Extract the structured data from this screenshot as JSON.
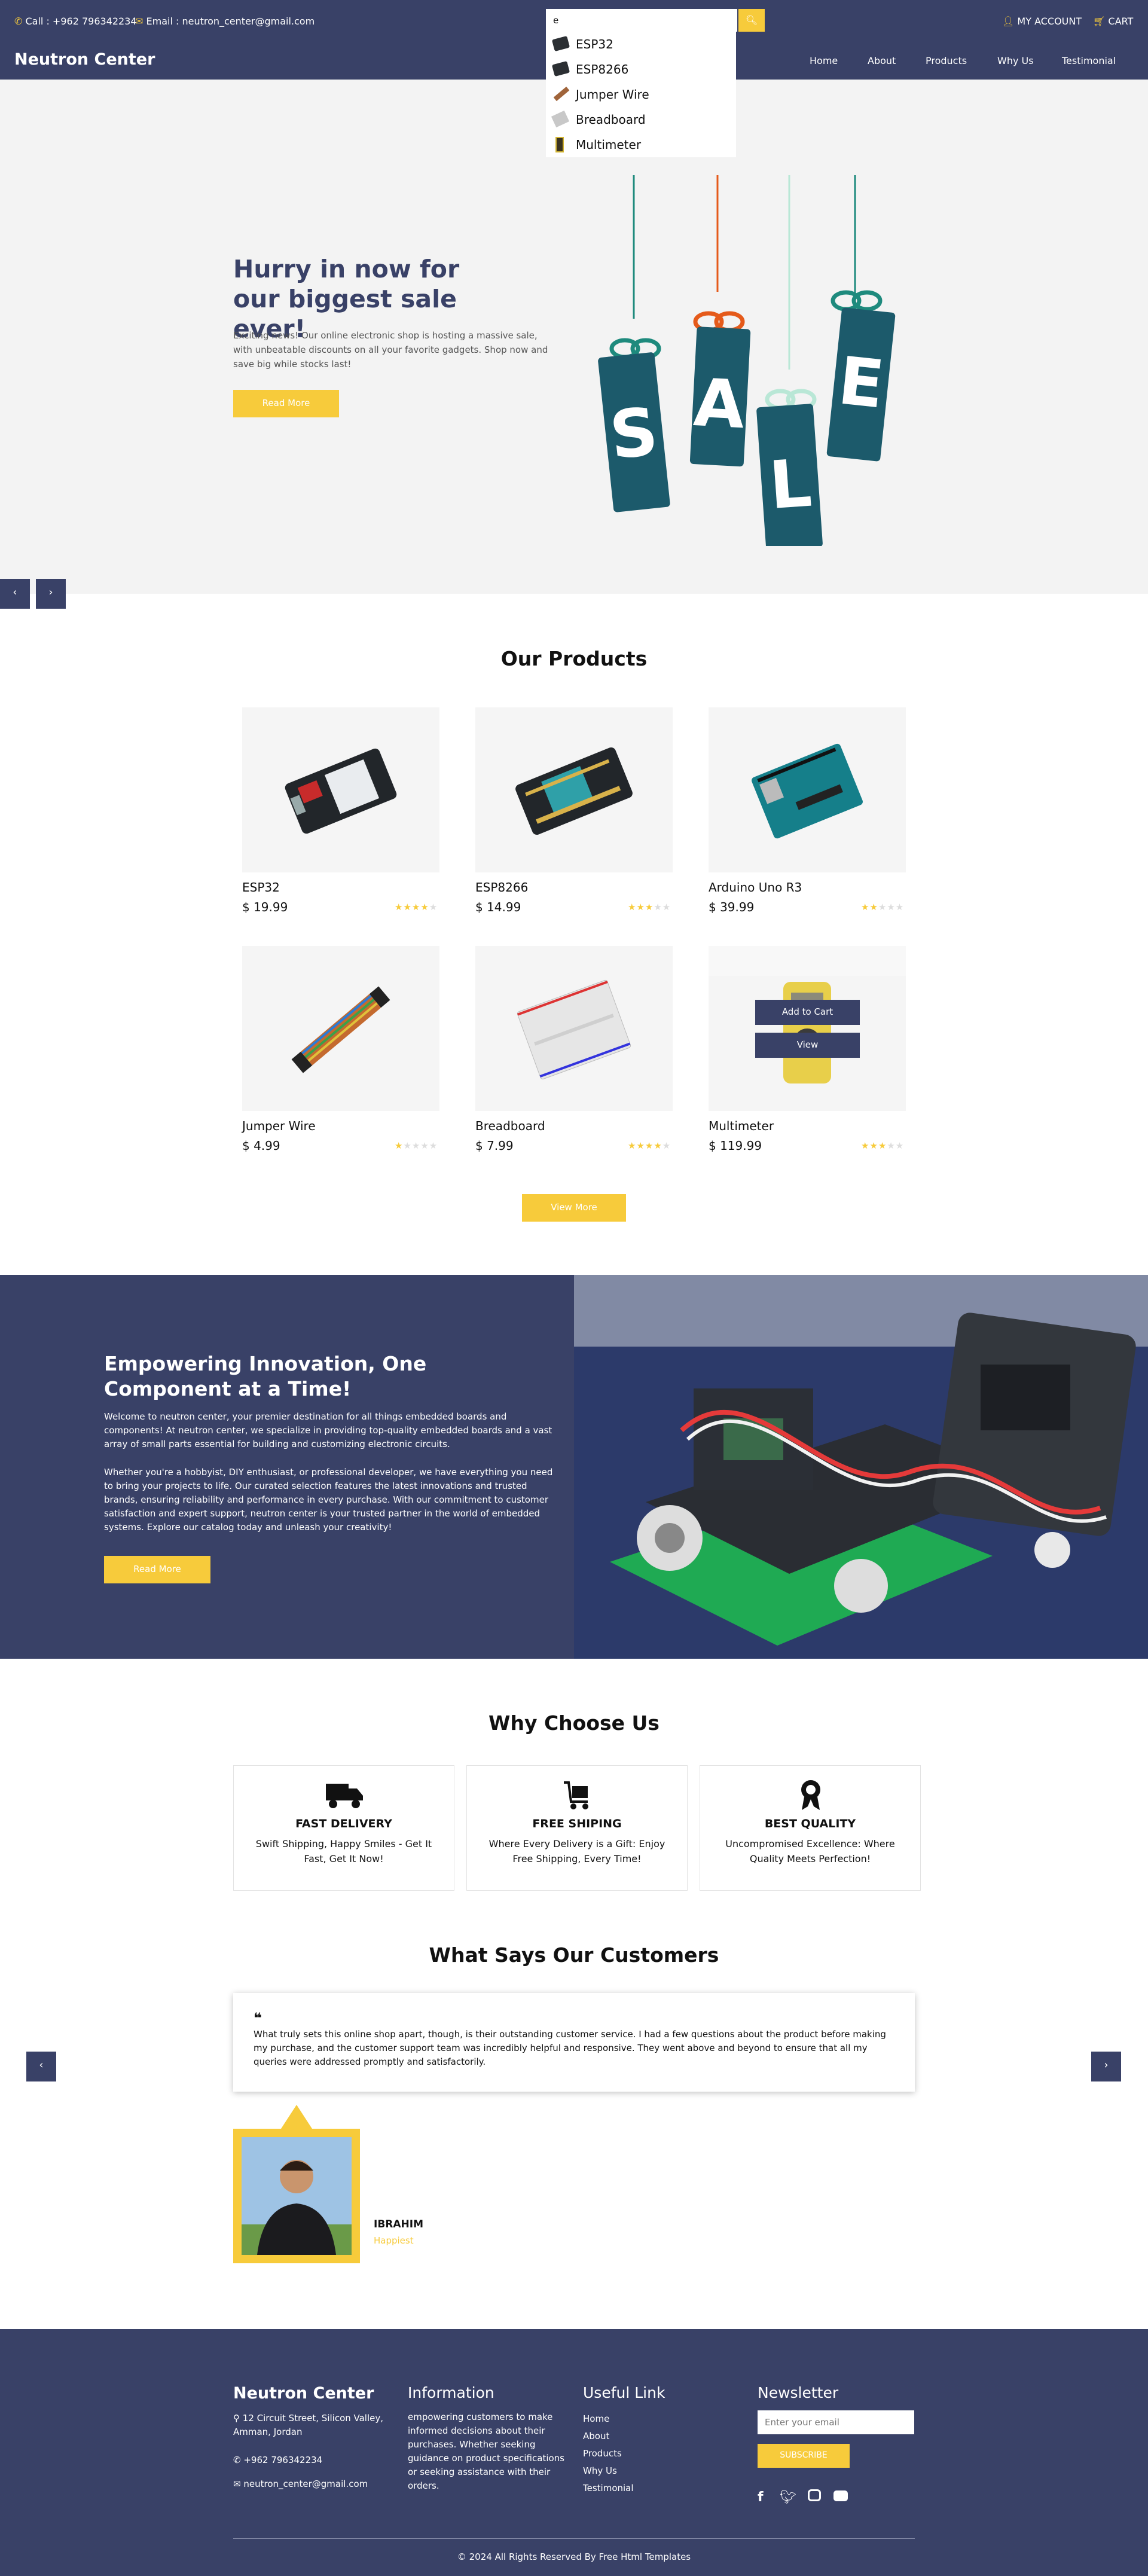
{
  "topbar": {
    "phone": "Call : +962 796342234",
    "email": "Email : neutron_center@gmail.com",
    "account": "MY ACCOUNT",
    "cart": "CART"
  },
  "search": {
    "value": "e",
    "placeholder": ""
  },
  "dropdown": [
    "ESP32",
    "ESP8266",
    "Jumper Wire",
    "Breadboard",
    "Multimeter"
  ],
  "brand": "Neutron Center",
  "nav": [
    "Home",
    "About",
    "Products",
    "Why Us",
    "Testimonial"
  ],
  "hero": {
    "title": "Hurry in now for our biggest sale ever!",
    "body": "Exciting news! Our online electronic shop is hosting a massive sale, with unbeatable discounts on all your favorite gadgets. Shop now and save big while stocks last!",
    "button": "Read More",
    "tags": [
      "S",
      "A",
      "L",
      "E"
    ]
  },
  "products": {
    "title": "Our Products",
    "items": [
      {
        "name": "ESP32",
        "price": "$ 19.99",
        "rating": 4
      },
      {
        "name": "ESP8266",
        "price": "$ 14.99",
        "rating": 3
      },
      {
        "name": "Arduino Uno R3",
        "price": "$ 39.99",
        "rating": 2
      },
      {
        "name": "Jumper Wire",
        "price": "$ 4.99",
        "rating": 1
      },
      {
        "name": "Breadboard",
        "price": "$ 7.99",
        "rating": 4
      },
      {
        "name": "Multimeter",
        "price": "$ 119.99",
        "rating": 3
      }
    ],
    "add_to_cart": "Add to Cart",
    "view": "View",
    "view_more": "View More"
  },
  "about": {
    "title": "Empowering Innovation, One Component at a Time!",
    "p1": "Welcome to neutron center, your premier destination for all things embedded boards and components! At neutron center, we specialize in providing top-quality embedded boards and a vast array of small parts essential for building and customizing electronic circuits.",
    "p2": "Whether you're a hobbyist, DIY enthusiast, or professional developer, we have everything you need to bring your projects to life. Our curated selection features the latest innovations and trusted brands, ensuring reliability and performance in every purchase. With our commitment to customer satisfaction and expert support, neutron center is your trusted partner in the world of embedded systems. Explore our catalog today and unleash your creativity!",
    "button": "Read More"
  },
  "why": {
    "title": "Why Choose Us",
    "items": [
      {
        "title": "FAST DELIVERY",
        "text": "Swift Shipping, Happy Smiles - Get It Fast, Get It Now!",
        "icon": "truck-icon"
      },
      {
        "title": "FREE SHIPING",
        "text": "Where Every Delivery is a Gift: Enjoy Free Shipping, Every Time!",
        "icon": "cart-icon"
      },
      {
        "title": "BEST QUALITY",
        "text": "Uncompromised Excellence: Where Quality Meets Perfection!",
        "icon": "award-icon"
      }
    ]
  },
  "testimonial": {
    "title": "What Says Our Customers",
    "quote": "What truly sets this online shop apart, though, is their outstanding customer service. I had a few questions about the product before making my purchase, and the customer support team was incredibly helpful and responsive. They went above and beyond to ensure that all my queries were addressed promptly and satisfactorily.",
    "name": "IBRAHIM",
    "role": "Happiest"
  },
  "footer": {
    "brand": "Neutron Center",
    "address": "12 Circuit Street, Silicon Valley, Amman, Jordan",
    "phone": "+962 796342234",
    "email": "neutron_center@gmail.com",
    "info_title": "Information",
    "info_text": "empowering customers to make informed decisions about their purchases. Whether seeking guidance on product specifications or seeking assistance with their orders.",
    "links_title": "Useful Link",
    "links": [
      "Home",
      "About",
      "Products",
      "Why Us",
      "Testimonial"
    ],
    "news_title": "Newsletter",
    "news_placeholder": "Enter your email",
    "subscribe": "SUBSCRIBE",
    "copyright": "© 2024 All Rights Reserved By Free Html Templates"
  },
  "colors": {
    "navy": "#394167",
    "accent": "#f7cb3b",
    "light": "#f3f3f3"
  }
}
